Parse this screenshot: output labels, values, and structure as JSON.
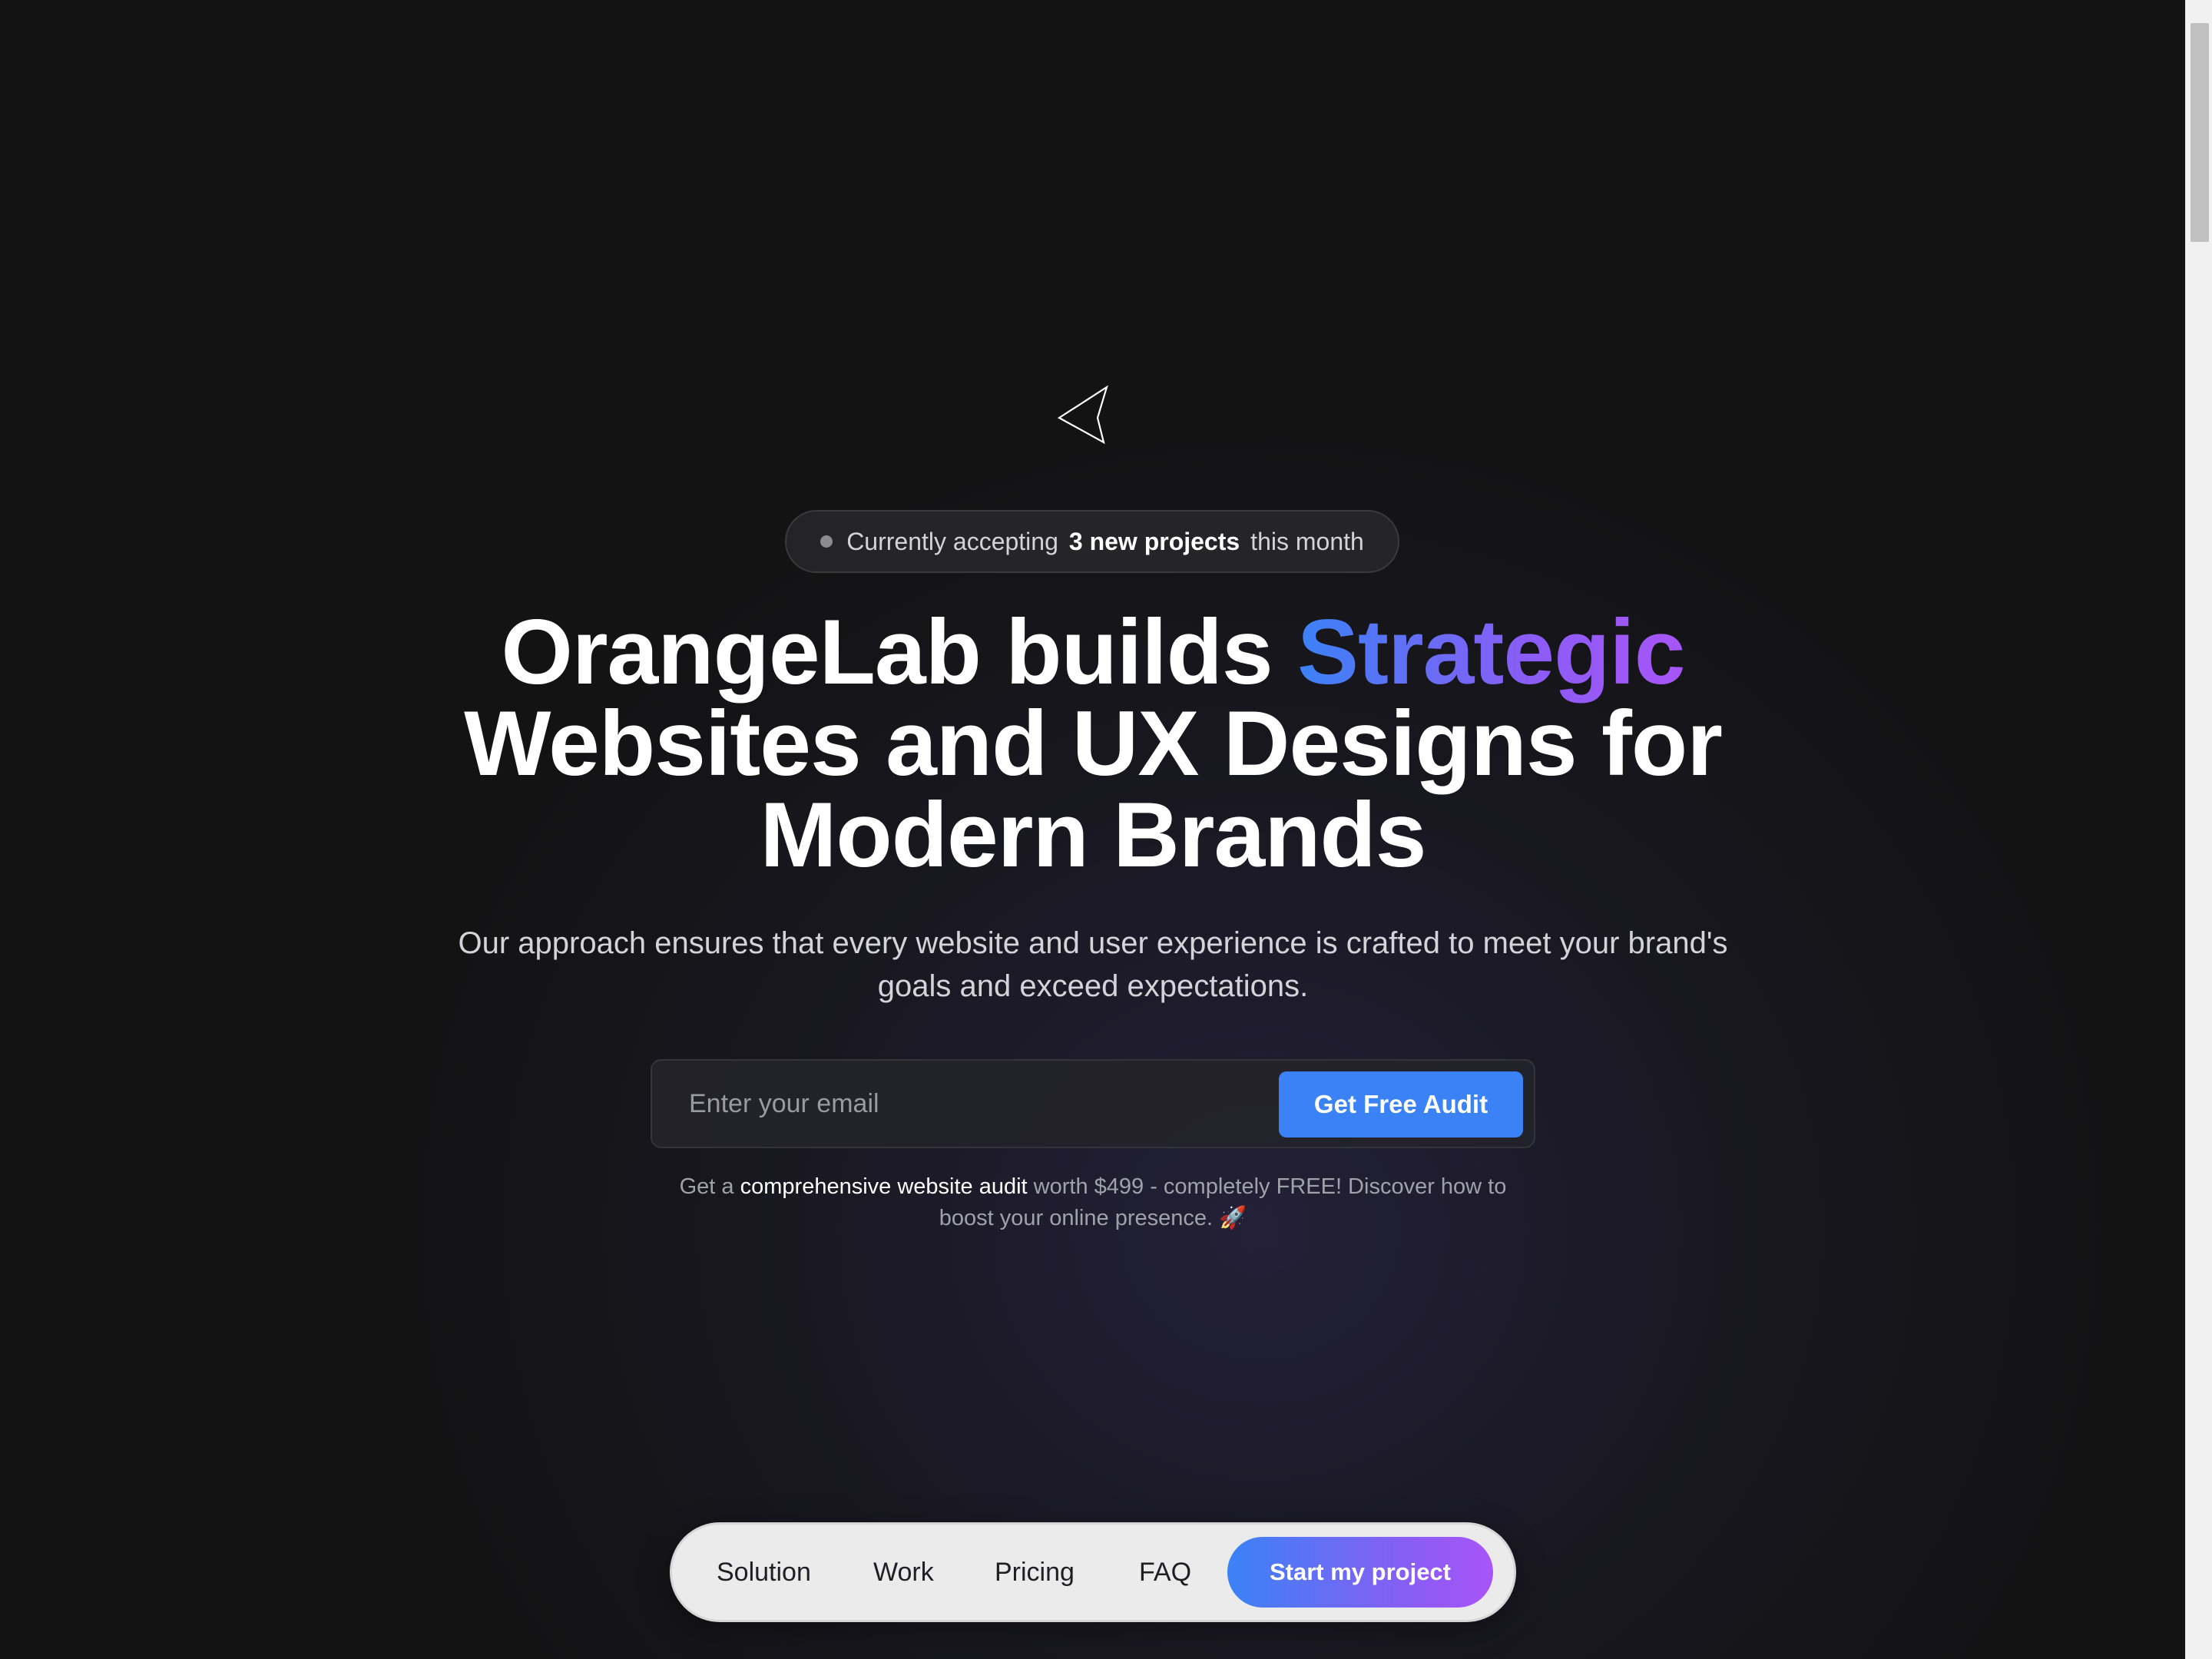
{
  "badge": {
    "prefix": "Currently accepting",
    "highlight": "3 new projects",
    "suffix": "this month"
  },
  "hero": {
    "headline_line1_main": "OrangeLab builds ",
    "headline_line1_accent": "Strategic",
    "headline_line2": "Websites and UX Designs for",
    "headline_line3": "Modern Brands",
    "subtitle": "Our approach ensures that every website and user experience is crafted to meet your brand's goals and exceed expectations.",
    "accent_gradient": [
      "#3b82f6",
      "#8b5cf6",
      "#a855f7"
    ]
  },
  "form": {
    "email_placeholder": "Enter your email",
    "email_value": "",
    "submit_label": "Get Free Audit",
    "button_color": "#3b82f6"
  },
  "audit_note": {
    "prefix": "Get a",
    "highlight": "comprehensive website audit",
    "suffix": "worth $499 - completely FREE! Discover how to boost your online presence.",
    "emoji": "🚀"
  },
  "icons": {
    "logo": "paper-plane-icon",
    "badge_status": "status-dot-icon"
  },
  "navbar": {
    "items": [
      {
        "label": "Solution"
      },
      {
        "label": "Work"
      },
      {
        "label": "Pricing"
      },
      {
        "label": "FAQ"
      }
    ],
    "cta_label": "Start my project"
  },
  "theme": {
    "background": "#131314",
    "text": "#ffffff",
    "muted_text": "#a1a1aa",
    "navbar_background": "#ebebeb"
  }
}
